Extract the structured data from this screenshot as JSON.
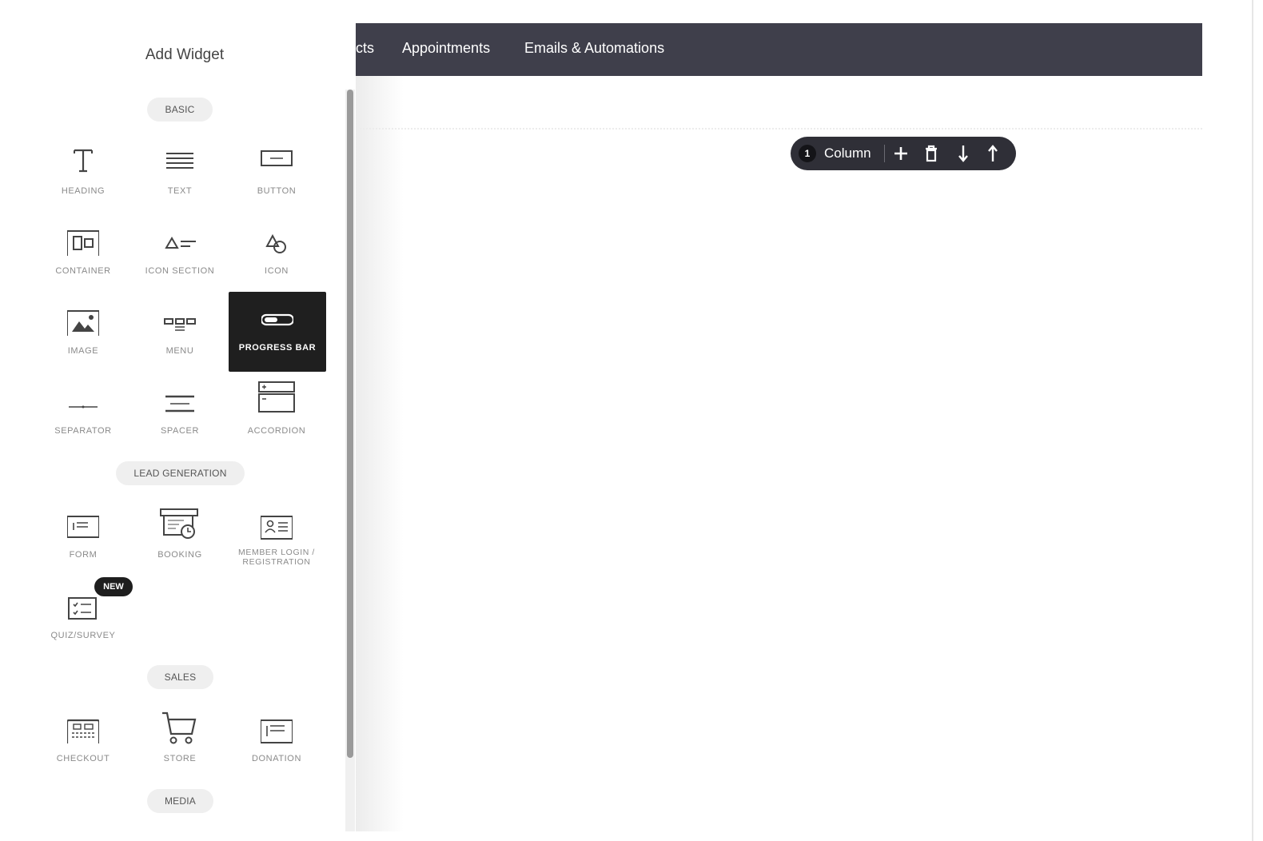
{
  "panel": {
    "title": "Add Widget",
    "sections": {
      "basic": "BASIC",
      "lead_generation": "LEAD GENERATION",
      "sales": "SALES",
      "media": "MEDIA"
    },
    "widgets": {
      "heading": "HEADING",
      "text": "TEXT",
      "button": "BUTTON",
      "container": "CONTAINER",
      "icon_section": "ICON SECTION",
      "icon": "ICON",
      "image": "IMAGE",
      "menu": "MENU",
      "progress_bar": "PROGRESS BAR",
      "separator": "SEPARATOR",
      "spacer": "SPACER",
      "accordion": "ACCORDION",
      "form": "FORM",
      "booking": "BOOKING",
      "member_login_1": "MEMBER LOGIN /",
      "member_login_2": "REGISTRATION",
      "quiz_survey": "QUIZ/SURVEY",
      "checkout": "CHECKOUT",
      "store": "STORE",
      "donation": "DONATION"
    },
    "new_badge": "NEW",
    "active_widget": "PROGRESS BAR"
  },
  "topnav": {
    "items": [
      "cts",
      "Appointments",
      "Emails & Automations"
    ]
  },
  "column_toolbar": {
    "count": "1",
    "label": "Column",
    "icons": [
      "plus-icon",
      "trash-icon",
      "arrow-down-icon",
      "arrow-up-icon"
    ]
  },
  "colors": {
    "nav_bg": "#3f3f4b",
    "toolbar_bg": "#2f2f37",
    "active_tile": "#1f1f1f"
  }
}
